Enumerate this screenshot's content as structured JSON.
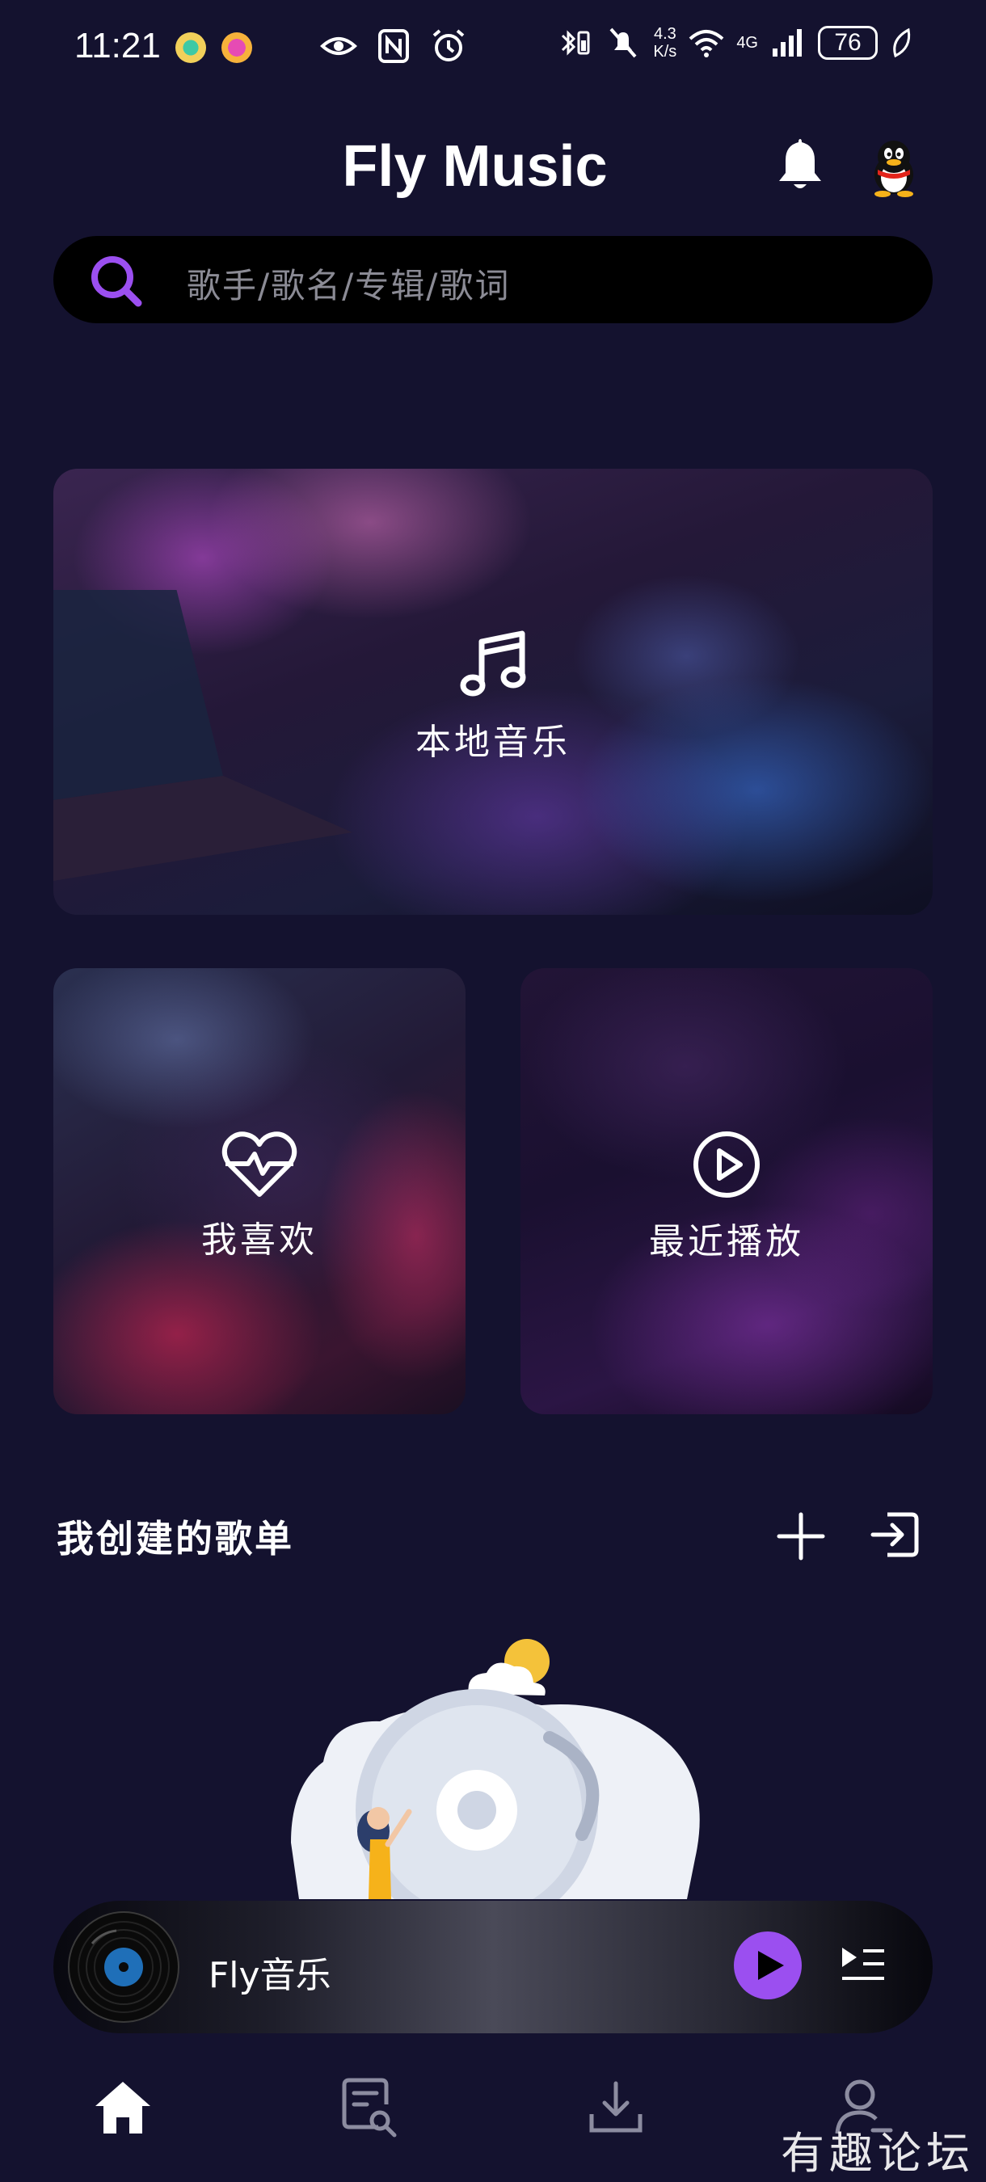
{
  "status_bar": {
    "time": "11:21",
    "net_speed_top": "4.3",
    "net_speed_bottom": "K/s",
    "network": "4G",
    "battery": "76"
  },
  "header": {
    "title": "Fly Music"
  },
  "search": {
    "placeholder": "歌手/歌名/专辑/歌词"
  },
  "cards": {
    "local": {
      "label": "本地音乐",
      "icon": "music-note-icon"
    },
    "favorites": {
      "label": "我喜欢",
      "icon": "heart-pulse-icon"
    },
    "recent": {
      "label": "最近播放",
      "icon": "play-circle-icon"
    }
  },
  "playlists": {
    "title": "我创建的歌单"
  },
  "player": {
    "song": "Fly音乐"
  },
  "tabs": [
    {
      "name": "home",
      "icon": "home-icon"
    },
    {
      "name": "discover",
      "icon": "document-search-icon"
    },
    {
      "name": "download",
      "icon": "download-icon"
    },
    {
      "name": "profile",
      "icon": "user-icon"
    }
  ],
  "watermark": "有趣论坛",
  "colors": {
    "background": "#14122f",
    "accent": "#9b4ff0",
    "search_bg": "#000000"
  }
}
